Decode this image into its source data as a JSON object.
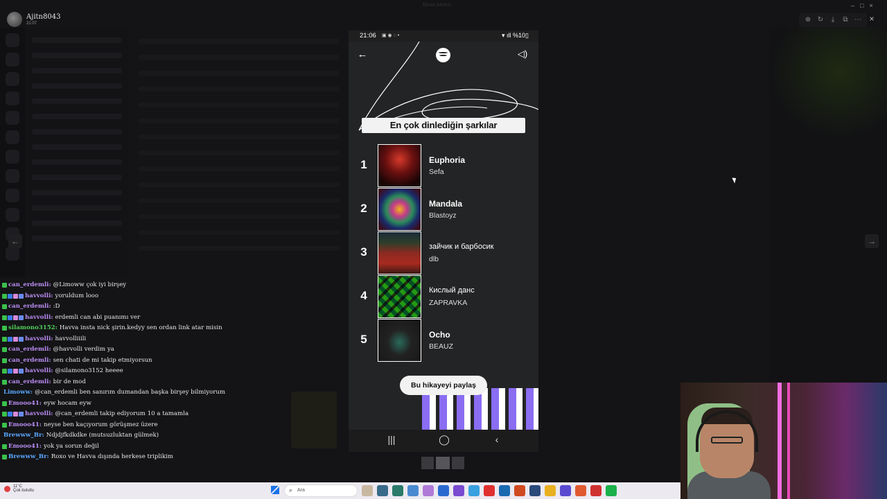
{
  "window": {
    "title": "Ekran Alıntısı",
    "controls": [
      "–",
      "□",
      "×"
    ]
  },
  "viewer": {
    "user": {
      "name": "Ajitn8043",
      "time": "21:07"
    },
    "tools": [
      "zoom-in-icon",
      "rotate-icon",
      "download-icon",
      "open-external-icon",
      "more-icon"
    ],
    "close_label": "×",
    "prev_label": "←",
    "next_label": "→"
  },
  "chat": [
    {
      "user": "can_erdemli",
      "color": "#b98cf2",
      "badges": [
        "g"
      ],
      "text": "@Limoww çok iyi birşey"
    },
    {
      "user": "havvolli",
      "color": "#b98cf2",
      "badges": [
        "g",
        "b",
        "p",
        "r"
      ],
      "text": "yoruldum looo"
    },
    {
      "user": "can_erdemli",
      "color": "#b98cf2",
      "badges": [
        "g"
      ],
      "text": ":D"
    },
    {
      "user": "havvolli",
      "color": "#b98cf2",
      "badges": [
        "g",
        "b",
        "p",
        "r"
      ],
      "text": "erdemli can abi puanımı ver"
    },
    {
      "user": "silamono3152",
      "color": "#52d05a",
      "badges": [
        "g"
      ],
      "text": "Havva insta nick şirin.kedyy sen ordan link atar misin"
    },
    {
      "user": "havvolli",
      "color": "#b98cf2",
      "badges": [
        "g",
        "b",
        "p",
        "r"
      ],
      "text": "havvolliiili"
    },
    {
      "user": "can_erdemli",
      "color": "#b98cf2",
      "badges": [
        "g"
      ],
      "text": "@havvolli verdim ya"
    },
    {
      "user": "can_erdemli",
      "color": "#b98cf2",
      "badges": [
        "g"
      ],
      "text": "sen chati de mi takip etmiyorsun"
    },
    {
      "user": "havvolli",
      "color": "#b98cf2",
      "badges": [
        "g",
        "b",
        "p",
        "r"
      ],
      "text": "@silamono3152 heeee"
    },
    {
      "user": "can_erdemli",
      "color": "#b98cf2",
      "badges": [
        "g"
      ],
      "text": "bir de mod"
    },
    {
      "user": "Limoww",
      "color": "#5aa8ff",
      "badges": [],
      "text": "@can_erdemli ben sanırım dumandan başka birşey bilmiyorum"
    },
    {
      "user": "Emooo41",
      "color": "#b98cf2",
      "badges": [
        "g"
      ],
      "text": "eyw hocam eyw"
    },
    {
      "user": "havvolli",
      "color": "#b98cf2",
      "badges": [
        "g",
        "b",
        "p",
        "r"
      ],
      "text": "@can_erdemli takip ediyorum 10 a tamamla"
    },
    {
      "user": "Emooo41",
      "color": "#b98cf2",
      "badges": [
        "g"
      ],
      "text": "neyse ben kaçıyorum görüşmez üzere"
    },
    {
      "user": "Brewww_Br",
      "color": "#5aa8ff",
      "badges": [],
      "text": "Ndjdjfkdkdke (mutsuzluktan gülmek)"
    },
    {
      "user": "Emooo41",
      "color": "#b98cf2",
      "badges": [
        "g"
      ],
      "text": "yok ya sorun değil"
    },
    {
      "user": "Brewww_Br",
      "color": "#5aa8ff",
      "badges": [
        "g"
      ],
      "text": "Roxo ve Havva dışında herkese triplikim"
    }
  ],
  "phone": {
    "status": {
      "time": "21:06",
      "icons": "▣ ◉ ◌ •",
      "right": "▾ ıll %10▯"
    },
    "back_label": "←",
    "sound_label": "◁)",
    "title": "En çok dinlediğin şarkılar",
    "tracks": [
      {
        "rank": "1",
        "title": "Euphoria",
        "artist": "Sefa",
        "bold": true
      },
      {
        "rank": "2",
        "title": "Mandala",
        "artist": "Blastoyz",
        "bold": true
      },
      {
        "rank": "3",
        "title": "зайчик и барбосик",
        "artist": "dlb",
        "bold": false
      },
      {
        "rank": "4",
        "title": "Кислый данс",
        "artist": "ZAPRAVKA",
        "bold": false
      },
      {
        "rank": "5",
        "title": "Ocho",
        "artist": "BEAUZ",
        "bold": true
      }
    ],
    "share_label": "Bu hikayeyi paylaş",
    "nav": {
      "recents": "|||",
      "home": "◯",
      "back": "‹"
    }
  },
  "taskbar": {
    "weather_temp": "11°C",
    "weather_desc": "Çok bulutlu",
    "search_placeholder": "Ara",
    "app_colors": [
      "#c9b8a0",
      "#3a6a8a",
      "#2a7a6a",
      "#4a8ad0",
      "#b07ad8",
      "#2a6ad0",
      "#7a4ad0",
      "#3aa0e0",
      "#e03030",
      "#1a6ab0",
      "#d04a20",
      "#2a4a7a",
      "#e8b020",
      "#5a4ad0",
      "#e05a30",
      "#d03030",
      "#1ab04a"
    ]
  }
}
